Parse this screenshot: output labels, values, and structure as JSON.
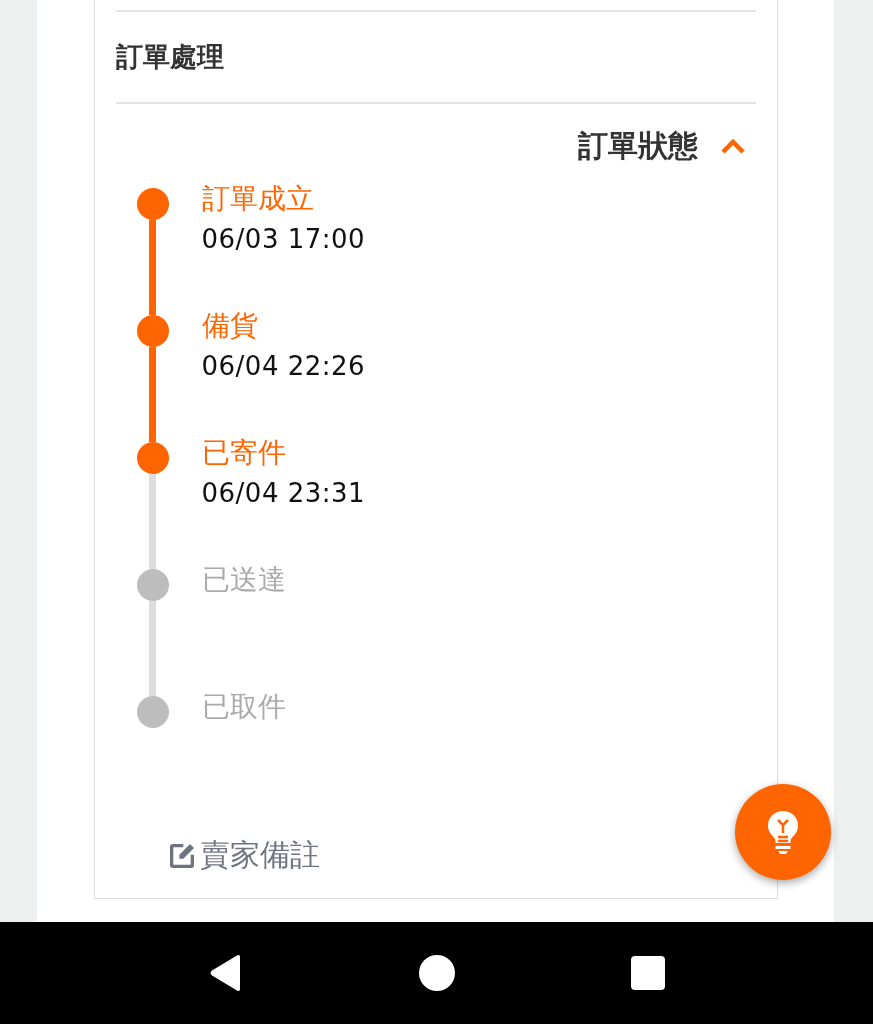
{
  "section_title": "訂單處理",
  "status_header": {
    "label": "訂單狀態",
    "expanded": true
  },
  "steps": [
    {
      "label": "訂單成立",
      "time": "06/03 17:00",
      "done": true
    },
    {
      "label": "備貨",
      "time": "06/04 22:26",
      "done": true
    },
    {
      "label": "已寄件",
      "time": "06/04 23:31",
      "done": true
    },
    {
      "label": "已送達",
      "done": false
    },
    {
      "label": "已取件",
      "done": false
    }
  ],
  "seller_note": "賣家備註"
}
